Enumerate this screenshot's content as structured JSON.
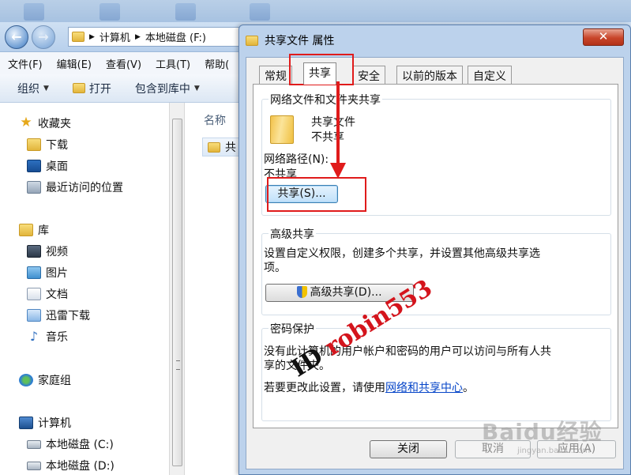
{
  "explorer": {
    "breadcrumb": [
      "计算机",
      "本地磁盘 (F:)"
    ],
    "menu": [
      "文件(F)",
      "编辑(E)",
      "查看(V)",
      "工具(T)",
      "帮助("
    ],
    "commands": {
      "organize": "组织",
      "open": "打开",
      "include_library": "包含到库中"
    },
    "nav": {
      "favorites": "收藏夹",
      "favorites_items": [
        "下载",
        "桌面",
        "最近访问的位置"
      ],
      "libraries": "库",
      "libraries_items": [
        "视频",
        "图片",
        "文档",
        "迅雷下载",
        "音乐"
      ],
      "homegroup": "家庭组",
      "computer": "计算机",
      "computer_items": [
        "本地磁盘 (C:)",
        "本地磁盘 (D:)"
      ]
    },
    "column_name": "名称",
    "file_item": "共"
  },
  "dialog": {
    "title": "共享文件 属性",
    "close_glyph": "✕",
    "tabs": [
      "常规",
      "共享",
      "安全",
      "以前的版本",
      "自定义"
    ],
    "network_sharing": {
      "title": "网络文件和文件夹共享",
      "folder_name": "共享文件",
      "folder_status": "不共享",
      "path_label": "网络路径(N):",
      "path_value": "不共享",
      "share_button": "共享(S)..."
    },
    "advanced_sharing": {
      "title": "高级共享",
      "desc_line1": "设置自定义权限，创建多个共享，并设置其他高级共享选",
      "desc_line2": "项。",
      "button": "高级共享(D)..."
    },
    "password": {
      "title": "密码保护",
      "desc_line1": "没有此计算机的用户帐户和密码的用户可以访问与所有人共",
      "desc_line2": "享的文件夹。",
      "change_prefix": "若要更改此设置，请使用",
      "change_link": "网络和共享中心",
      "change_suffix": "。"
    },
    "buttons": {
      "close": "关闭",
      "cancel": "取消",
      "apply": "应用(A)"
    }
  },
  "watermark": {
    "id": "ID",
    "name": "robin553"
  },
  "baidu_watermark": {
    "main": "Baidu经验",
    "sub": "jingyan.baidu.com"
  },
  "colors": {
    "highlight": "#e01b1b",
    "link": "#0645c8",
    "title_bar": "#bcd2ec"
  }
}
